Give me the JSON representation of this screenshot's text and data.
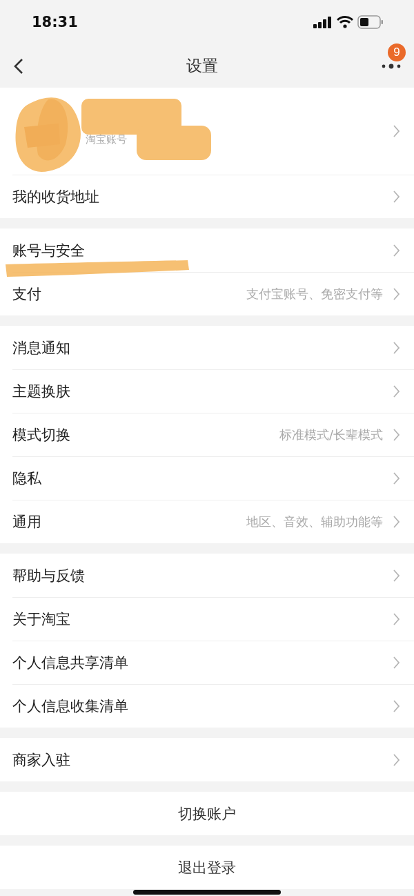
{
  "status_bar": {
    "time": "18:31"
  },
  "nav_bar": {
    "title": "设置",
    "badge": "9"
  },
  "profile": {
    "account_label": "淘宝账号"
  },
  "groups": [
    {
      "rows": [
        {
          "kind": "nav",
          "label": "我的收货地址"
        }
      ]
    },
    {
      "rows": [
        {
          "kind": "nav",
          "label": "账号与安全"
        },
        {
          "kind": "nav",
          "label": "支付",
          "hint": "支付宝账号、免密支付等"
        }
      ]
    },
    {
      "rows": [
        {
          "kind": "nav",
          "label": "消息通知"
        },
        {
          "kind": "nav",
          "label": "主题换肤"
        },
        {
          "kind": "nav",
          "label": "模式切换",
          "hint": "标准模式/长辈模式"
        },
        {
          "kind": "nav",
          "label": "隐私"
        },
        {
          "kind": "nav",
          "label": "通用",
          "hint": "地区、音效、辅助功能等"
        }
      ]
    },
    {
      "rows": [
        {
          "kind": "nav",
          "label": "帮助与反馈"
        },
        {
          "kind": "nav",
          "label": "关于淘宝"
        },
        {
          "kind": "nav",
          "label": "个人信息共享清单"
        },
        {
          "kind": "nav",
          "label": "个人信息收集清单"
        }
      ]
    },
    {
      "rows": [
        {
          "kind": "nav",
          "label": "商家入驻"
        }
      ]
    },
    {
      "rows": [
        {
          "kind": "action",
          "label": "切换账户"
        }
      ]
    },
    {
      "rows": [
        {
          "kind": "action",
          "label": "退出登录"
        }
      ]
    }
  ]
}
